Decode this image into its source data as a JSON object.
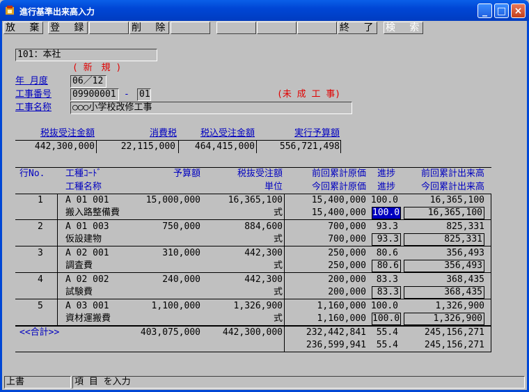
{
  "window": {
    "title": "進行基準出来高入力",
    "min": "_",
    "max": "□",
    "close": "×"
  },
  "toolbar": [
    {
      "label": "放 棄",
      "enabled": true
    },
    {
      "label": "登 録",
      "enabled": true
    },
    {
      "label": "",
      "enabled": true
    },
    {
      "label": "削 除",
      "enabled": true
    },
    {
      "label": "",
      "enabled": true
    },
    {
      "label": "",
      "enabled": true
    },
    {
      "label": "",
      "enabled": true
    },
    {
      "label": "",
      "enabled": true
    },
    {
      "label": "終 了",
      "enabled": true
    },
    {
      "label": "検 索",
      "enabled": false
    }
  ],
  "header": {
    "office": "101：本社",
    "mode": "( 新　規 )",
    "year_month_label": "年 月度",
    "year_month": "06／12",
    "project_no_label": "工事番号",
    "project_no": "09900001",
    "project_sep": "-",
    "project_sub": "01",
    "project_status": "(未 成 工 事)",
    "project_name_label": "工事名称",
    "project_name": "○○○小学校改修工事"
  },
  "summary": {
    "headers": [
      "税抜受注金額",
      "消費税",
      "税込受注金額",
      "実行予算額"
    ],
    "values": [
      "442,300,000",
      "22,115,000",
      "464,415,000",
      "556,721,498"
    ]
  },
  "grid": {
    "header1": [
      "行No.",
      "工種ｺｰﾄﾞ",
      "予算額",
      "税抜受注額",
      "前回累計原価",
      "進捗",
      "前回累計出来高"
    ],
    "header2": [
      "工種名称",
      "単位",
      "今回累計原価",
      "進捗",
      "今回累計出来高"
    ],
    "rows": [
      {
        "no": "1",
        "code": "A 01 001",
        "budget": "15,000,000",
        "order": "16,365,100",
        "prev_cost": "15,400,000",
        "prev_pct": "100.0",
        "prev_done": "16,365,100",
        "name": "搬入路整備費",
        "unit": "式",
        "cur_cost": "15,400,000",
        "cur_pct": "100.0",
        "cur_done": "16,365,100"
      },
      {
        "no": "2",
        "code": "A 01 003",
        "budget": "750,000",
        "order": "884,600",
        "prev_cost": "700,000",
        "prev_pct": "93.3",
        "prev_done": "825,331",
        "name": "仮設建物",
        "unit": "式",
        "cur_cost": "700,000",
        "cur_pct": "93.3",
        "cur_done": "825,331"
      },
      {
        "no": "3",
        "code": "A 02 001",
        "budget": "310,000",
        "order": "442,300",
        "prev_cost": "250,000",
        "prev_pct": "80.6",
        "prev_done": "356,493",
        "name": "調査費",
        "unit": "式",
        "cur_cost": "250,000",
        "cur_pct": "80.6",
        "cur_done": "356,493"
      },
      {
        "no": "4",
        "code": "A 02 002",
        "budget": "240,000",
        "order": "442,300",
        "prev_cost": "200,000",
        "prev_pct": "83.3",
        "prev_done": "368,435",
        "name": "試験費",
        "unit": "式",
        "cur_cost": "200,000",
        "cur_pct": "83.3",
        "cur_done": "368,435"
      },
      {
        "no": "5",
        "code": "A 03 001",
        "budget": "1,100,000",
        "order": "1,326,900",
        "prev_cost": "1,160,000",
        "prev_pct": "100.0",
        "prev_done": "1,326,900",
        "name": "資材運搬費",
        "unit": "式",
        "cur_cost": "1,160,000",
        "cur_pct": "100.0",
        "cur_done": "1,326,900"
      }
    ],
    "total": {
      "label": "<<合計>>",
      "budget": "403,075,000",
      "order": "442,300,000",
      "prev_cost": "232,442,841",
      "prev_pct": "55.4",
      "prev_done": "245,156,271",
      "cur_cost": "236,599,941",
      "cur_pct": "55.4",
      "cur_done": "245,156,271"
    }
  },
  "status": {
    "mode": "上書",
    "message": "項 目 を入力"
  }
}
